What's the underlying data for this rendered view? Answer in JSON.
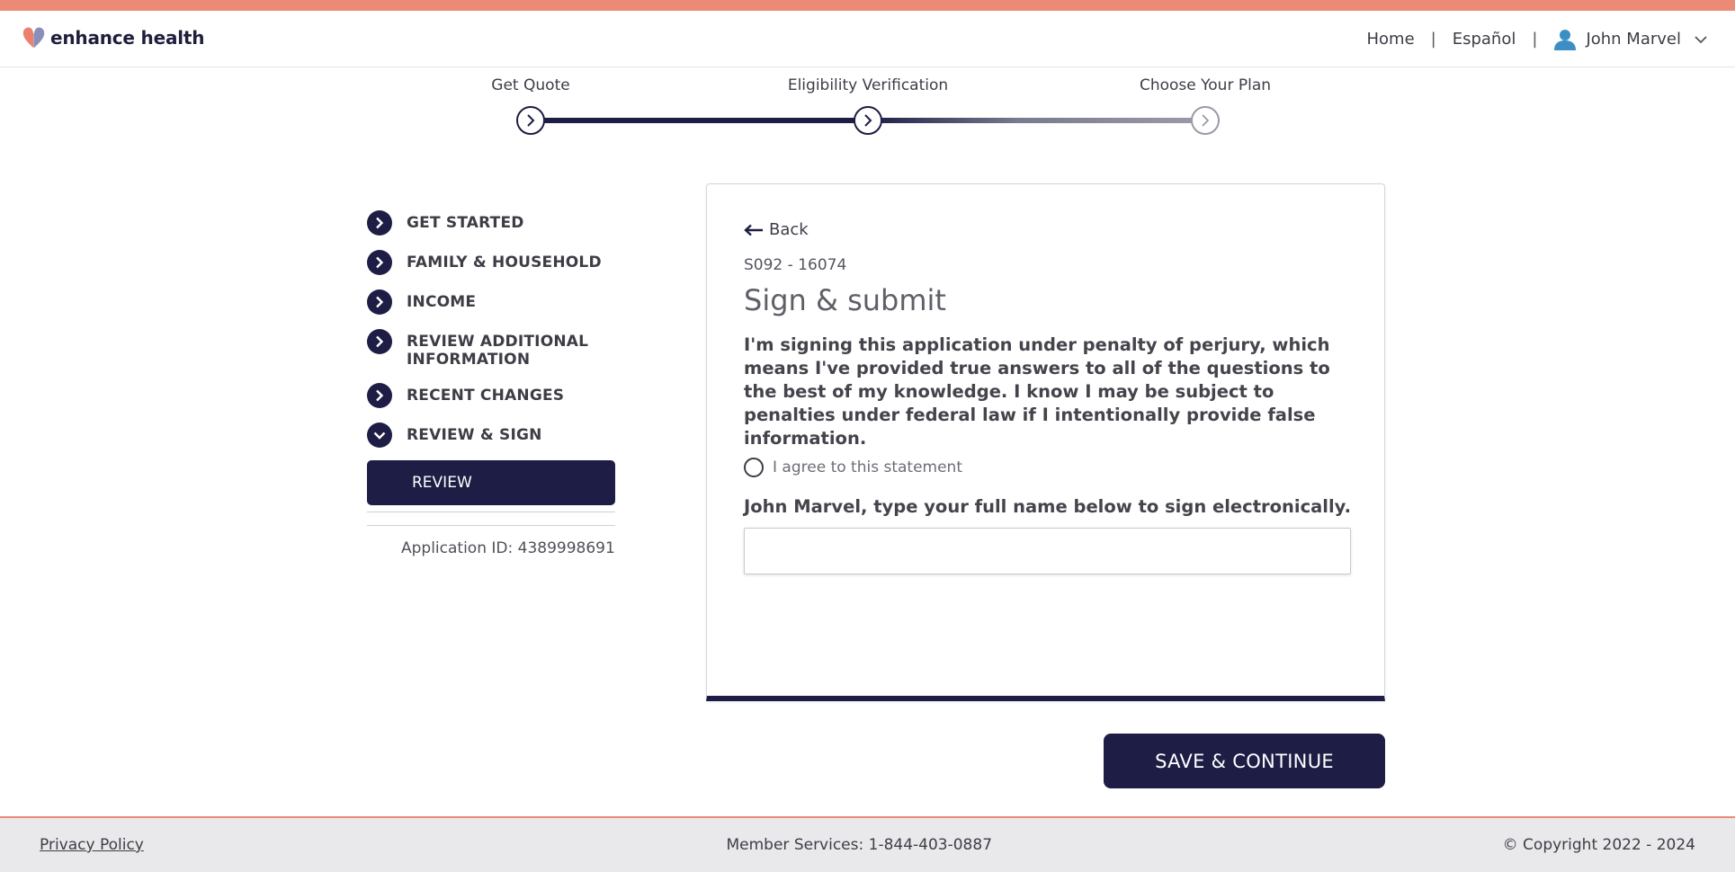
{
  "brand": {
    "name": "enhance health",
    "stripe_color": "#ec8a78",
    "primary_color": "#1d1d45"
  },
  "header": {
    "nav_home": "Home",
    "nav_separator": "|",
    "nav_language": "Español",
    "user_name": "John Marvel"
  },
  "stepper": {
    "steps": [
      {
        "label": "Get Quote",
        "state": "complete"
      },
      {
        "label": "Eligibility Verification",
        "state": "current"
      },
      {
        "label": "Choose Your Plan",
        "state": "upcoming"
      }
    ]
  },
  "sidebar": {
    "items": [
      {
        "label": "GET STARTED",
        "icon": "chevron-right-icon"
      },
      {
        "label": "FAMILY & HOUSEHOLD",
        "icon": "chevron-right-icon"
      },
      {
        "label": "INCOME",
        "icon": "chevron-right-icon"
      },
      {
        "label": "REVIEW ADDITIONAL INFORMATION",
        "icon": "chevron-right-icon"
      },
      {
        "label": "RECENT CHANGES",
        "icon": "chevron-right-icon"
      },
      {
        "label": "REVIEW & SIGN",
        "icon": "chevron-down-icon"
      }
    ],
    "sub_item": "REVIEW",
    "application_id": "Application ID: 4389998691"
  },
  "card": {
    "back_label": "Back",
    "form_id": "S092 - 16074",
    "title": "Sign & submit",
    "statement": "I'm signing this application under penalty of perjury, which means I've provided true answers to all of the questions to the best of my knowledge. I know I may be subject to penalties under federal law if I intentionally provide false information.",
    "agree_label": "I agree to this statement",
    "agree_checked": false,
    "sign_label": "John Marvel, type your full name below to sign electronically.",
    "sign_value": ""
  },
  "actions": {
    "save_continue": "SAVE & CONTINUE"
  },
  "footer": {
    "privacy": "Privacy Policy",
    "member_services": "Member Services: 1-844-403-0887",
    "copyright": "© Copyright 2022 - 2024"
  }
}
